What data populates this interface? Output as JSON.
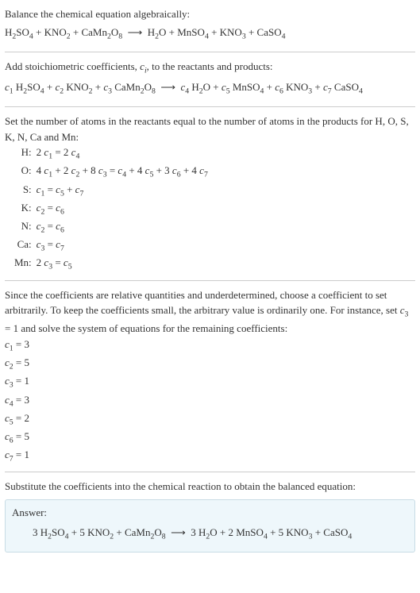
{
  "intro1": "Balance the chemical equation algebraically:",
  "reaction1": "H₂SO₄ + KNO₂ + CaMn₂O₈ ⟶ H₂O + MnSO₄ + KNO₃ + CaSO₄",
  "intro2_a": "Add stoichiometric coefficients, ",
  "intro2_ci": "cᵢ",
  "intro2_b": ", to the reactants and products:",
  "reaction2": "c₁ H₂SO₄ + c₂ KNO₂ + c₃ CaMn₂O₈ ⟶ c₄ H₂O + c₅ MnSO₄ + c₆ KNO₃ + c₇ CaSO₄",
  "intro3": "Set the number of atoms in the reactants equal to the number of atoms in the products for H, O, S, K, N, Ca and Mn:",
  "eqs": [
    {
      "label": "H:",
      "val": "2 c₁ = 2 c₄"
    },
    {
      "label": "O:",
      "val": "4 c₁ + 2 c₂ + 8 c₃ = c₄ + 4 c₅ + 3 c₆ + 4 c₇"
    },
    {
      "label": "S:",
      "val": "c₁ = c₅ + c₇"
    },
    {
      "label": "K:",
      "val": "c₂ = c₆"
    },
    {
      "label": "N:",
      "val": "c₂ = c₆"
    },
    {
      "label": "Ca:",
      "val": "c₃ = c₇"
    },
    {
      "label": "Mn:",
      "val": "2 c₃ = c₅"
    }
  ],
  "intro4": "Since the coefficients are relative quantities and underdetermined, choose a coefficient to set arbitrarily. To keep the coefficients small, the arbitrary value is ordinarily one. For instance, set c₃ = 1 and solve the system of equations for the remaining coefficients:",
  "coefs": [
    "c₁ = 3",
    "c₂ = 5",
    "c₃ = 1",
    "c₄ = 3",
    "c₅ = 2",
    "c₆ = 5",
    "c₇ = 1"
  ],
  "intro5": "Substitute the coefficients into the chemical reaction to obtain the balanced equation:",
  "answer_label": "Answer:",
  "answer_eq": "3 H₂SO₄ + 5 KNO₂ + CaMn₂O₈ ⟶ 3 H₂O + 2 MnSO₄ + 5 KNO₃ + CaSO₄"
}
